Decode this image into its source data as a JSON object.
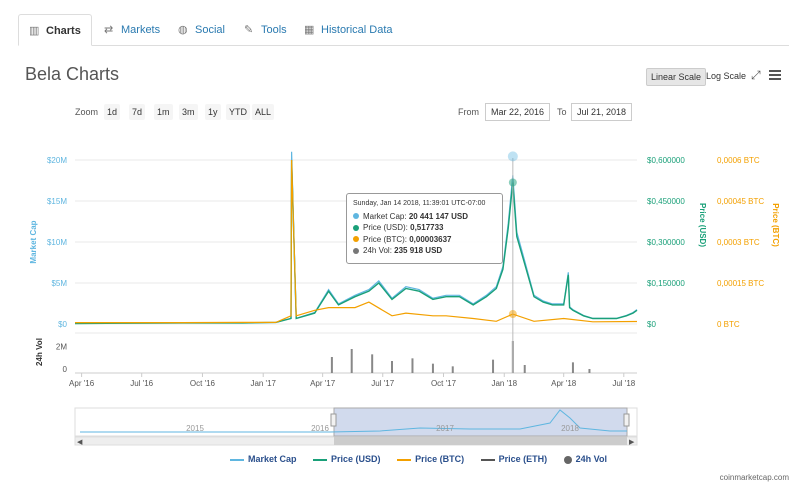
{
  "tabs": [
    {
      "label": "Charts",
      "icon": "bar-chart-icon",
      "active": true
    },
    {
      "label": "Markets",
      "icon": "exchange-icon",
      "active": false
    },
    {
      "label": "Social",
      "icon": "globe-icon",
      "active": false
    },
    {
      "label": "Tools",
      "icon": "wrench-icon",
      "active": false
    },
    {
      "label": "Historical Data",
      "icon": "calendar-icon",
      "active": false
    }
  ],
  "title": "Bela Charts",
  "scale": {
    "linear": "Linear Scale",
    "log": "Log Scale"
  },
  "zoom": {
    "label": "Zoom",
    "options": [
      "1d",
      "7d",
      "1m",
      "3m",
      "1y",
      "YTD",
      "ALL"
    ]
  },
  "range": {
    "from_label": "From",
    "from": "Mar 22, 2016",
    "to_label": "To",
    "to": "Jul 21, 2018"
  },
  "tooltip": {
    "header": "Sunday, Jan 14 2018, 11:39:01 UTC-07:00",
    "rows": [
      {
        "label": "Market Cap:",
        "value": "20 441 147 USD",
        "color": "#5fb6e0"
      },
      {
        "label": "Price (USD):",
        "value": "0,517733",
        "color": "#1aa079"
      },
      {
        "label": "Price (BTC):",
        "value": "0,00003637",
        "color": "#f3a000"
      },
      {
        "label": "24h Vol:",
        "value": "235 918 USD",
        "color": "#777777"
      }
    ]
  },
  "legend": [
    {
      "label": "Market Cap",
      "color": "#5fb6e0"
    },
    {
      "label": "Price (USD)",
      "color": "#1aa079"
    },
    {
      "label": "Price (BTC)",
      "color": "#f3a000"
    },
    {
      "label": "Price (ETH)",
      "color": "#555555"
    },
    {
      "label": "24h Vol",
      "color": "#777777"
    }
  ],
  "credit": "coinmarketcap.com",
  "chart_data": {
    "type": "line",
    "title": "Bela Charts",
    "x_axis": {
      "type": "date",
      "ticks": [
        "Apr '16",
        "Jul '16",
        "Oct '16",
        "Jan '17",
        "Apr '17",
        "Jul '17",
        "Oct '17",
        "Jan '18",
        "Apr '18",
        "Jul '18"
      ]
    },
    "y_axes": [
      {
        "label": "Market Cap",
        "ticks": [
          "$0",
          "$5M",
          "$10M",
          "$15M",
          "$20M"
        ],
        "range": [
          0,
          20000000
        ],
        "color": "#5fb6e0"
      },
      {
        "label": "Price (USD)",
        "ticks": [
          "$0",
          "$0,150000",
          "$0,300000",
          "$0,450000",
          "$0,600000"
        ],
        "range": [
          0,
          0.6
        ],
        "color": "#1aa079"
      },
      {
        "label": "Price (BTC)",
        "ticks": [
          "0 BTC",
          "0,00015 BTC",
          "0,0003 BTC",
          "0,00045 BTC",
          "0,0006 BTC"
        ],
        "range": [
          0,
          0.0006
        ],
        "color": "#f3a000"
      },
      {
        "label": "24h Vol",
        "ticks": [
          "0",
          "2M"
        ],
        "range": [
          0,
          3000000
        ],
        "color": "#555555"
      }
    ],
    "navigator_labels": [
      "2015",
      "2016",
      "2017",
      "2018"
    ],
    "price_usd": {
      "dates": [
        "2016-03-22",
        "2016-06-01",
        "2016-09-01",
        "2016-12-01",
        "2017-01-20",
        "2017-02-12",
        "2017-02-13",
        "2017-02-20",
        "2017-03-20",
        "2017-04-10",
        "2017-04-25",
        "2017-05-20",
        "2017-06-10",
        "2017-06-25",
        "2017-07-15",
        "2017-08-05",
        "2017-08-25",
        "2017-09-15",
        "2017-10-05",
        "2017-10-25",
        "2017-11-15",
        "2017-12-05",
        "2017-12-20",
        "2017-12-30",
        "2018-01-07",
        "2018-01-14",
        "2018-01-20",
        "2018-02-01",
        "2018-02-15",
        "2018-03-01",
        "2018-03-15",
        "2018-04-01",
        "2018-04-08",
        "2018-04-10",
        "2018-04-15",
        "2018-05-01",
        "2018-05-15",
        "2018-06-01",
        "2018-06-20",
        "2018-07-05",
        "2018-07-15",
        "2018-07-21"
      ],
      "values": [
        0.002,
        0.003,
        0.004,
        0.004,
        0.006,
        0.02,
        0.6,
        0.02,
        0.04,
        0.12,
        0.07,
        0.1,
        0.12,
        0.15,
        0.09,
        0.13,
        0.12,
        0.09,
        0.1,
        0.1,
        0.07,
        0.1,
        0.13,
        0.2,
        0.35,
        0.518,
        0.32,
        0.22,
        0.1,
        0.08,
        0.07,
        0.07,
        0.18,
        0.06,
        0.05,
        0.03,
        0.02,
        0.02,
        0.02,
        0.03,
        0.04,
        0.05
      ]
    },
    "price_btc": {
      "dates": [
        "2016-03-22",
        "2016-09-01",
        "2016-12-01",
        "2017-01-20",
        "2017-02-12",
        "2017-02-13",
        "2017-02-20",
        "2017-03-20",
        "2017-04-10",
        "2017-05-20",
        "2017-06-10",
        "2017-07-15",
        "2017-08-05",
        "2017-09-15",
        "2017-10-05",
        "2017-11-15",
        "2017-12-20",
        "2018-01-14",
        "2018-02-15",
        "2018-04-01",
        "2018-05-15",
        "2018-07-21"
      ],
      "values": [
        5e-06,
        5e-06,
        6e-06,
        6e-06,
        3e-05,
        0.0006,
        3e-05,
        5e-05,
        6e-05,
        6e-05,
        8e-05,
        3e-05,
        4e-05,
        3e-05,
        3e-05,
        2e-05,
        1e-05,
        3.637e-05,
        1e-05,
        2e-05,
        8e-06,
        9e-06
      ]
    },
    "volume": {
      "dates": [
        "2017-04-15",
        "2017-05-15",
        "2017-06-15",
        "2017-07-15",
        "2017-08-15",
        "2017-09-15",
        "2017-10-15",
        "2017-12-15",
        "2018-01-14",
        "2018-02-01",
        "2018-04-15",
        "2018-05-10"
      ],
      "values": [
        1200000,
        1800000,
        1400000,
        900000,
        1100000,
        700000,
        500000,
        1000000,
        2400000,
        600000,
        800000,
        300000
      ]
    },
    "hovered": {
      "date": "2018-01-14",
      "market_cap": 20441147,
      "price_usd": 0.517733,
      "price_btc": 3.637e-05,
      "volume_24h": 235918
    }
  }
}
